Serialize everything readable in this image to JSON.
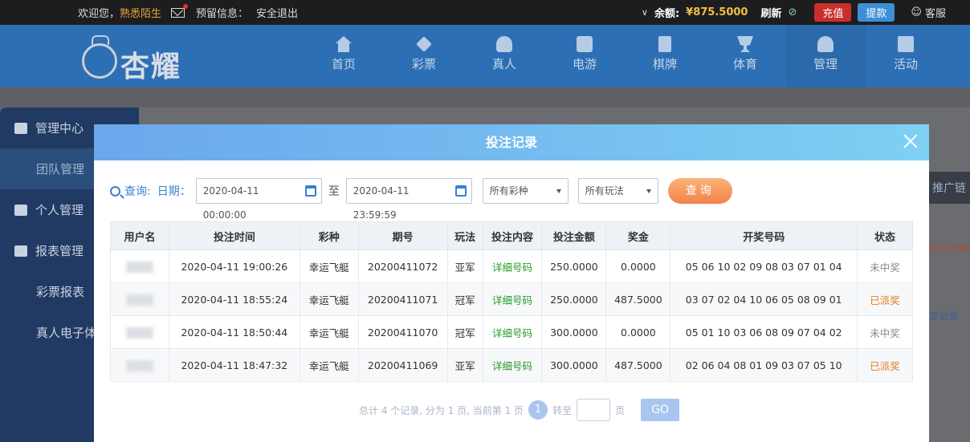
{
  "topbar": {
    "welcome": "欢迎您，",
    "username": "熟悉陌生",
    "reserved_label": "预留信息：",
    "logout": "安全退出",
    "balance_label": "余额:",
    "balance_value": "¥875.5000",
    "refresh": "刷新",
    "recharge": "充值",
    "withdraw": "提款",
    "service": "客服"
  },
  "logo": {
    "text": "杏耀"
  },
  "nav": [
    {
      "label": "首页",
      "icon": "home-icon"
    },
    {
      "label": "彩票",
      "icon": "lottery-icon"
    },
    {
      "label": "真人",
      "icon": "live-icon"
    },
    {
      "label": "电游",
      "icon": "slot-icon"
    },
    {
      "label": "棋牌",
      "icon": "cards-icon"
    },
    {
      "label": "体育",
      "icon": "trophy-icon"
    },
    {
      "label": "管理",
      "icon": "users-icon"
    },
    {
      "label": "活动",
      "icon": "gift-icon"
    }
  ],
  "sidebar": {
    "items": [
      {
        "label": "管理中心",
        "icon": "users-icon"
      },
      {
        "label": "团队管理"
      },
      {
        "label": "个人管理",
        "icon": "user-icon"
      },
      {
        "label": "报表管理",
        "icon": "report-icon"
      },
      {
        "label": "彩票报表"
      },
      {
        "label": "真人电子体"
      }
    ]
  },
  "right_partial": {
    "promo": "推广链",
    "hint": "可点击标题",
    "record": "变记录"
  },
  "modal": {
    "title": "投注记录",
    "filter": {
      "query_label": "查询:",
      "date_label": "日期：",
      "start": "2020-04-11 00:00:00",
      "to": "至",
      "end": "2020-04-11 23:59:59",
      "lottery_select": "所有彩种",
      "play_select": "所有玩法",
      "query_button": "查询"
    },
    "table": {
      "headers": [
        "用户名",
        "投注时间",
        "彩种",
        "期号",
        "玩法",
        "投注内容",
        "投注金额",
        "奖金",
        "开奖号码",
        "状态"
      ],
      "rows": [
        {
          "user": "",
          "time": "2020-04-11 19:00:26",
          "lottery": "幸运飞艇",
          "issue": "20200411072",
          "play": "亚军",
          "content": "详细号码",
          "amount": "250.0000",
          "bonus": "0.0000",
          "numbers": "05 06 10 02 09 08 03 07 01 04",
          "status": "未中奖"
        },
        {
          "user": "",
          "time": "2020-04-11 18:55:24",
          "lottery": "幸运飞艇",
          "issue": "20200411071",
          "play": "冠军",
          "content": "详细号码",
          "amount": "250.0000",
          "bonus": "487.5000",
          "numbers": "03 07 02 04 10 06 05 08 09 01",
          "status": "已派奖"
        },
        {
          "user": "",
          "time": "2020-04-11 18:50:44",
          "lottery": "幸运飞艇",
          "issue": "20200411070",
          "play": "冠军",
          "content": "详细号码",
          "amount": "300.0000",
          "bonus": "0.0000",
          "numbers": "05 01 10 03 06 08 09 07 04 02",
          "status": "未中奖"
        },
        {
          "user": "",
          "time": "2020-04-11 18:47:32",
          "lottery": "幸运飞艇",
          "issue": "20200411069",
          "play": "亚军",
          "content": "详细号码",
          "amount": "300.0000",
          "bonus": "487.5000",
          "numbers": "02 06 04 08 01 09 03 07 05 10",
          "status": "已派奖"
        }
      ]
    },
    "pager": {
      "summary": "总计 4 个记录, 分为 1 页, 当前第 1 页",
      "current": "1",
      "goto_label": "转至",
      "page_unit": "页",
      "go": "GO"
    }
  }
}
